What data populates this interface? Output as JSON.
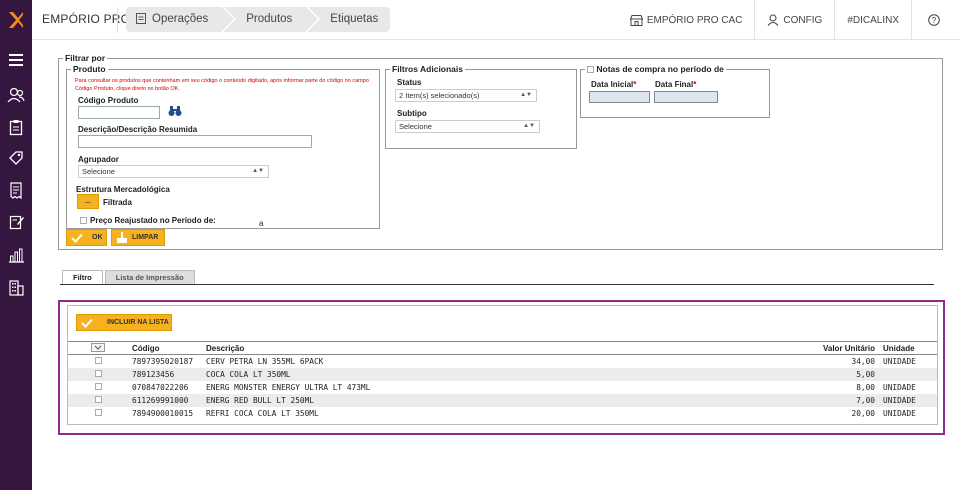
{
  "header": {
    "brand": "EMPÓRIO PRO",
    "breadcrumbs": [
      {
        "label": "Operações"
      },
      {
        "label": "Produtos"
      },
      {
        "label": "Etiquetas"
      }
    ],
    "right_items": [
      {
        "label": "EMPÓRIO PRO CAC",
        "icon": "store-icon"
      },
      {
        "label": "CONFIG",
        "icon": "user-icon"
      },
      {
        "label": "#DICALINX",
        "icon": ""
      },
      {
        "label": "",
        "icon": "help-icon"
      }
    ]
  },
  "sidebar": {
    "icons": [
      "menu-icon",
      "users-icon",
      "clipboard-icon",
      "tag-icon",
      "receipt-icon",
      "edit-note-icon",
      "bar-chart-icon",
      "building-icon"
    ]
  },
  "filter": {
    "legend": "Filtrar por",
    "produto": {
      "legend": "Produto",
      "hint": "Para consultar os produtos que contenham em seu código o conteúdo digitado, após informar parte do código no campo Código Produto, clique direto no botão OK.",
      "codigo_label": "Código Produto",
      "codigo_value": "",
      "descricao_label": "Descrição/Descrição Resumida",
      "descricao_value": "",
      "agrupador_label": "Agrupador",
      "agrupador_value": "Selecione",
      "estrutura_label": "Estrutura Mercadológica",
      "estrutura_btn": "...",
      "estrutura_value": "Filtrada",
      "preco_label": "Preço Reajustado no Período de:",
      "preco_sep": "a"
    },
    "adicionais": {
      "legend": "Filtros Adicionais",
      "status_label": "Status",
      "status_value": "2 Item(s) selecionado(s)",
      "subtipo_label": "Subtipo",
      "subtipo_value": "Selecione"
    },
    "notas": {
      "legend": "Notas de compra no período de",
      "data_inicial_label": "Data Inicial",
      "data_final_label": "Data Final",
      "required_mark": "*"
    },
    "ok_label": "OK",
    "limpar_label": "LIMPAR"
  },
  "tabs": [
    {
      "label": "Filtro",
      "active": true
    },
    {
      "label": "Lista de Impressão",
      "active": false
    }
  ],
  "results": {
    "incluir_label": "INCLUIR NA LISTA",
    "columns": [
      "",
      "Código",
      "Descrição",
      "Valor Unitário",
      "Unidade"
    ],
    "rows": [
      {
        "codigo": "7897395020187",
        "descricao": "CERV PETRA LN 355ML 6PACK",
        "valor": "34,00",
        "unidade": "UNIDADE"
      },
      {
        "codigo": "789123456",
        "descricao": "COCA COLA LT 350ML",
        "valor": "5,00",
        "unidade": ""
      },
      {
        "codigo": "070847022206",
        "descricao": "ENERG MONSTER ENERGY ULTRA LT 473ML",
        "valor": "8,00",
        "unidade": "UNIDADE"
      },
      {
        "codigo": "611269991000",
        "descricao": "ENERG RED BULL LT 250ML",
        "valor": "7,00",
        "unidade": "UNIDADE"
      },
      {
        "codigo": "7894900010015",
        "descricao": "REFRI COCA COLA LT 350ML",
        "valor": "20,00",
        "unidade": "UNIDADE"
      }
    ]
  },
  "colors": {
    "sidebar": "#35163f",
    "accent": "#f5b11f",
    "highlight_border": "#8e2a92",
    "required": "#d10000"
  }
}
